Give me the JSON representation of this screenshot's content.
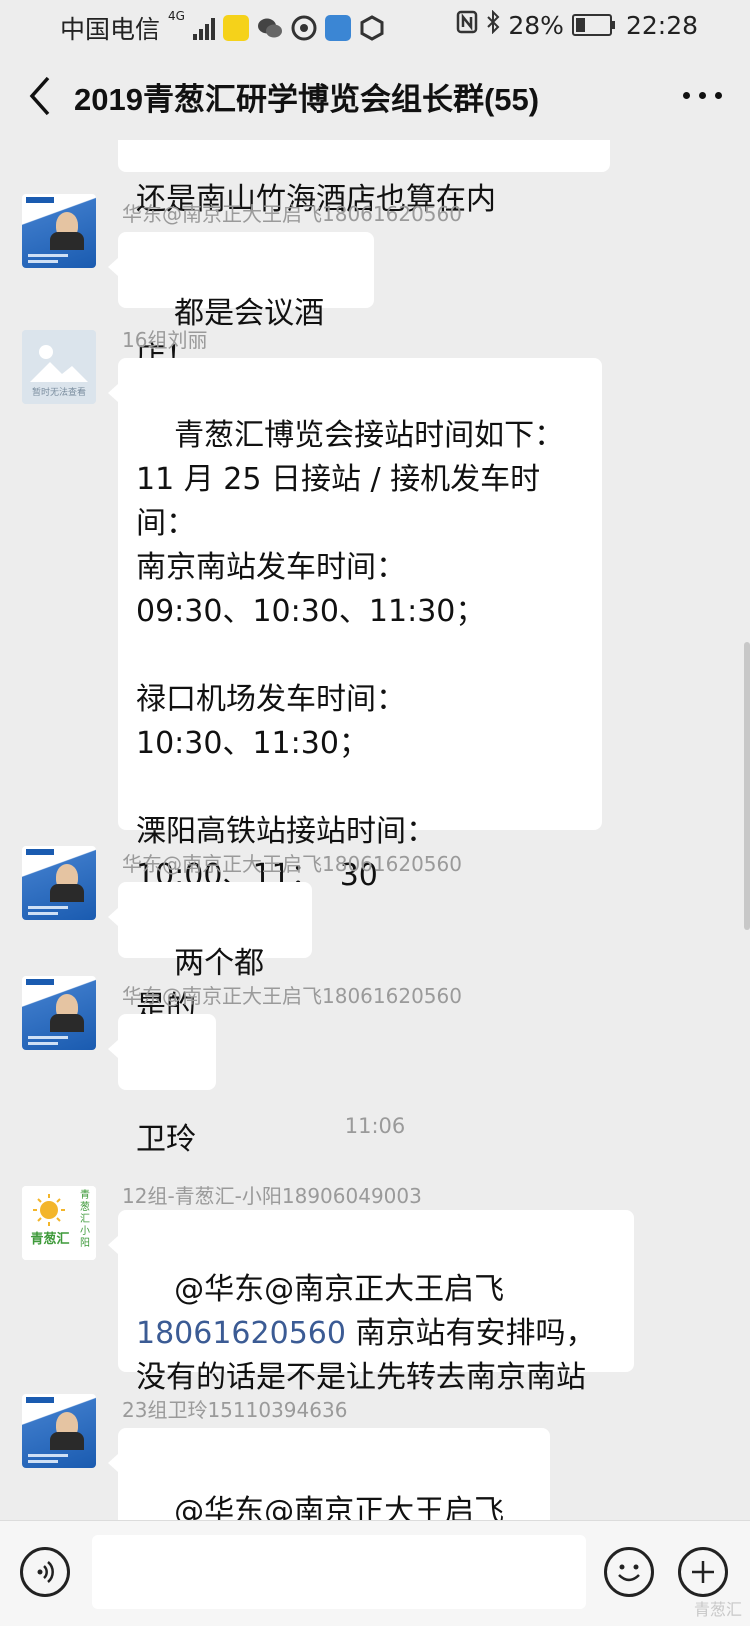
{
  "status_bar": {
    "carrier": "中国电信",
    "network": "4G",
    "battery": "28%",
    "battery_level": 0.28,
    "time": "22:28",
    "icons": [
      "signal-icon",
      "reading-app-icon",
      "wechat-icon",
      "app-icon",
      "cloud-app-icon",
      "settings-app-icon",
      "nfc-icon",
      "bluetooth-icon",
      "battery-icon"
    ]
  },
  "header": {
    "title": "2019青葱汇研学博览会组长群(55)",
    "back_icon": "chevron-left-icon",
    "more_icon": "more-dots-icon"
  },
  "messages": [
    {
      "type": "partial",
      "text": "还是南山竹海酒店也算在内"
    },
    {
      "type": "msg",
      "sender": "华东@南京正大王启飞18061620560",
      "text": "都是会议酒店！"
    },
    {
      "type": "msg",
      "sender": "16组刘丽",
      "text": "青葱汇博览会接站时间如下：\n11 月 25 日接站 / 接机发车时间：\n南京南站发车时间：\n09:30、10:30、11:30；\n\n禄口机场发车时间：\n10:30、11:30；\n\n溧阳高铁站接站时间：\n10:00、11：  30"
    },
    {
      "type": "msg",
      "sender": "华东@南京正大王启飞18061620560",
      "text": "两个都是的"
    },
    {
      "type": "msg",
      "sender": "华东@南京正大王启飞18061620560",
      "text": "卫玲"
    },
    {
      "type": "time",
      "text": "11:06"
    },
    {
      "type": "msg",
      "sender": "12组-青葱汇-小阳18906049003",
      "text_before": "@华东@南京正大王启飞\n",
      "link": "18061620560",
      "text_after": " 南京站有安排吗，没有的话是不是让先转去南京南站"
    },
    {
      "type": "msg",
      "sender": "23组卫玲15110394636",
      "text": "@华东@南京正大王启飞"
    }
  ],
  "avatars": {
    "green_avatar_text": "青葱汇",
    "green_avatar_side": "青葱汇小阳",
    "grey_avatar_caption": "暂时无法查看"
  },
  "input_bar": {
    "voice_icon": "voice-icon",
    "emoji_icon": "emoji-icon",
    "plus_icon": "plus-icon",
    "input_value": ""
  },
  "watermark": "青葱汇"
}
